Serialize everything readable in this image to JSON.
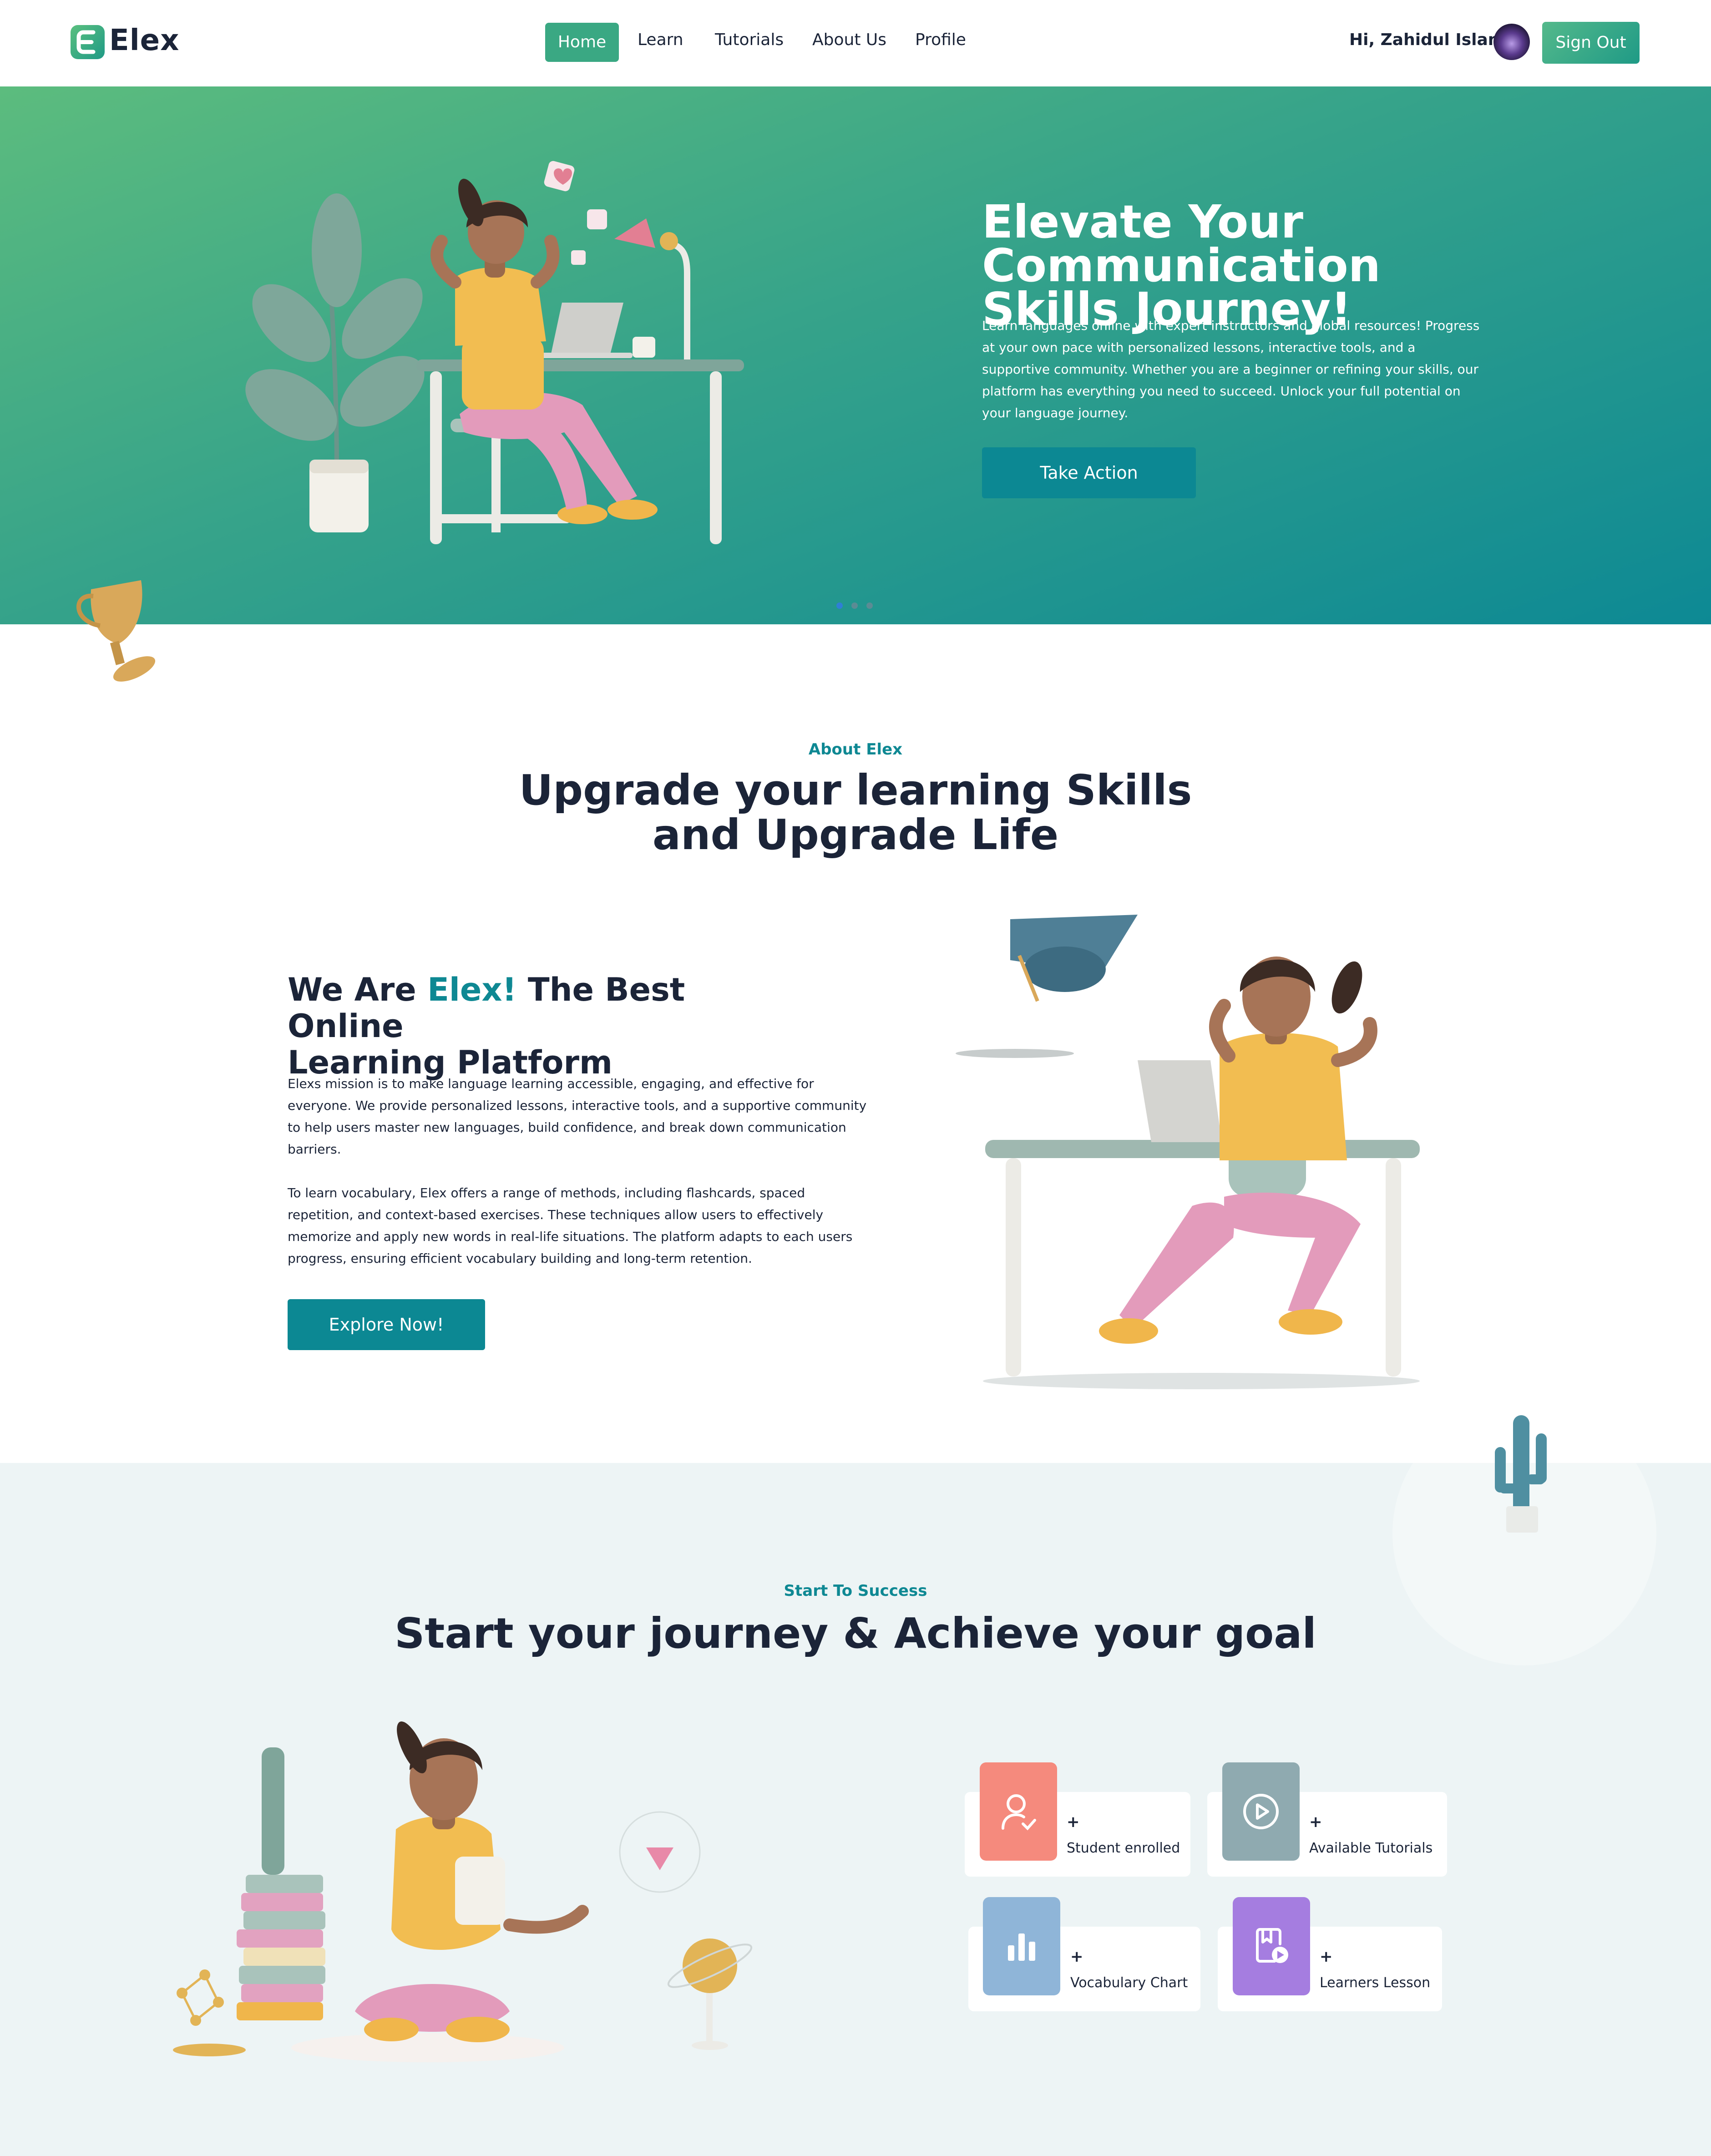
{
  "nav": {
    "logo_letter": "E",
    "logo_text": "Elex",
    "links": [
      "Home",
      "Learn",
      "Tutorials",
      "About Us",
      "Profile"
    ],
    "greeting": "Hi, Zahidul Islam",
    "sign_out": "Sign Out"
  },
  "hero": {
    "title_line1": "Elevate Your Communication",
    "title_line2": "Skills Journey!",
    "description": "Learn languages online with expert instructors and global resources! Progress at your own pace with personalized lessons, interactive tools, and a supportive community. Whether you are a beginner or refining your skills, our platform has everything you need to succeed. Unlock your full potential on your language journey.",
    "cta": "Take Action",
    "slides_count": 3,
    "active_slide": 1
  },
  "about": {
    "eyebrow": "About Elex",
    "title_line1": "Upgrade your learning Skills",
    "title_line2": "and Upgrade Life",
    "heading_pre": "We Are ",
    "heading_accent": "Elex!",
    "heading_post": " The Best Online",
    "heading_line2": "Learning Platform",
    "para1": "Elexs mission is to make language learning accessible, engaging, and effective for everyone. We provide personalized lessons, interactive tools, and a supportive community to help users master new languages, build confidence, and break down communication barriers.",
    "para2": "To learn vocabulary, Elex offers a range of methods, including flashcards, spaced repetition, and context-based exercises. These techniques allow users to effectively memorize and apply new words in real-life situations. The platform adapts to each users progress, ensuring efficient vocabulary building and long-term retention.",
    "cta": "Explore Now!"
  },
  "journey": {
    "eyebrow": "Start To Success",
    "title": "Start your journey & Achieve your goal",
    "stats": [
      {
        "value": "+",
        "label": "Student enrolled",
        "icon": "user-check-icon",
        "color": "#f58a7d"
      },
      {
        "value": "+",
        "label": "Available Tutorials",
        "icon": "play-circle-icon",
        "color": "#8faab0"
      },
      {
        "value": "+",
        "label": "Vocabulary Chart",
        "icon": "bar-chart-icon",
        "color": "#8fb5d8"
      },
      {
        "value": "+",
        "label": "Learners Lesson",
        "icon": "video-lesson-icon",
        "color": "#a57de0"
      }
    ]
  },
  "colors": {
    "brand": "#0e8893",
    "accent_green": "#3aa883",
    "text_dark": "#1b2438",
    "section_bg": "#edf4f5"
  }
}
